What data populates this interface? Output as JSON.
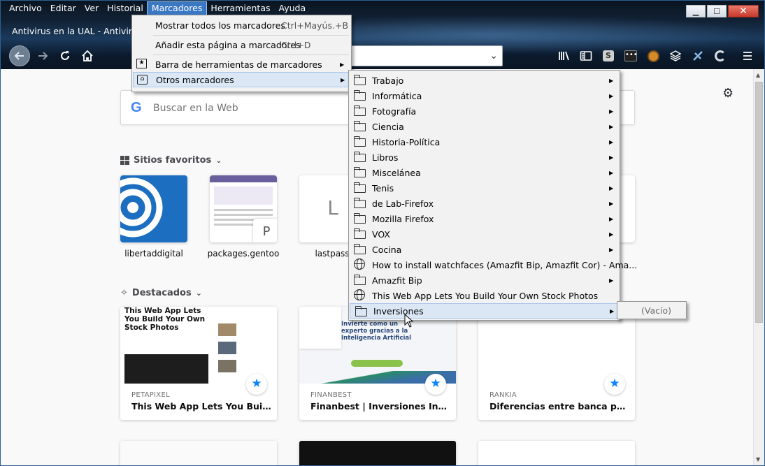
{
  "menubar": {
    "items": [
      "Archivo",
      "Editar",
      "Ver",
      "Historial",
      "Marcadores",
      "Herramientas",
      "Ayuda"
    ],
    "active": "Marcadores"
  },
  "tab": {
    "title": "Antivirus en la UAL - Antivirus -"
  },
  "window_controls": {
    "minimize": "▁",
    "maximize": "☐",
    "close": "✕"
  },
  "search": {
    "placeholder": "Buscar en la Web",
    "logo": "G"
  },
  "sections": {
    "top_sites": "Sitios favoritos",
    "highlights": "Destacados"
  },
  "top_sites": [
    {
      "label": "libertaddigital"
    },
    {
      "label": "packages.gentoo",
      "badge": "P"
    },
    {
      "label": "lastpass",
      "letter": "L"
    }
  ],
  "highlights": [
    {
      "source": "PETAPIXEL",
      "title": "This Web App Lets You Build Your...",
      "image_heading": "This Web App Lets You Build Your Own Stock Photos"
    },
    {
      "source": "FINANBEST",
      "title": "Finanbest | Inversiones Inteligentes",
      "image_heading": "Invierte como un experto gracias a la Inteligencia Artificial"
    },
    {
      "source": "RANKIA",
      "title": "Diferencias entre banca personal y..."
    }
  ],
  "bookmarks_menu": [
    {
      "label": "Mostrar todos los marcadores",
      "shortcut": "Ctrl+Mayús.+B"
    },
    {
      "label": "Añadir esta página a marcadores",
      "shortcut": "Ctrl+D"
    },
    {
      "label": "Barra de herramientas de marcadores",
      "submenu": true
    },
    {
      "label": "Otros marcadores",
      "submenu": true
    }
  ],
  "other_bookmarks": [
    {
      "label": "Trabajo",
      "type": "folder"
    },
    {
      "label": "Informática",
      "type": "folder"
    },
    {
      "label": "Fotografía",
      "type": "folder"
    },
    {
      "label": "Ciencia",
      "type": "folder"
    },
    {
      "label": "Historia-Política",
      "type": "folder"
    },
    {
      "label": "Libros",
      "type": "folder"
    },
    {
      "label": "Miscelánea",
      "type": "folder"
    },
    {
      "label": "Tenis",
      "type": "folder"
    },
    {
      "label": "de Lab-Firefox",
      "type": "folder"
    },
    {
      "label": "Mozilla Firefox",
      "type": "folder"
    },
    {
      "label": "VOX",
      "type": "folder"
    },
    {
      "label": "Cocina",
      "type": "folder"
    },
    {
      "label": "How to install watchfaces (Amazfit Bip, Amazfit Cor) - Ama...",
      "type": "link"
    },
    {
      "label": "Amazfit Bip",
      "type": "folder"
    },
    {
      "label": "This Web App Lets You Build Your Own Stock Photos",
      "type": "link"
    },
    {
      "label": "Inversiones",
      "type": "folder",
      "highlighted": true
    }
  ],
  "inversiones_submenu": {
    "empty_label": "(Vacío)"
  },
  "colors": {
    "accent": "#0a84ff",
    "menu_highlight": "#dbe7f5",
    "menubar_active": "#3a78c4"
  }
}
